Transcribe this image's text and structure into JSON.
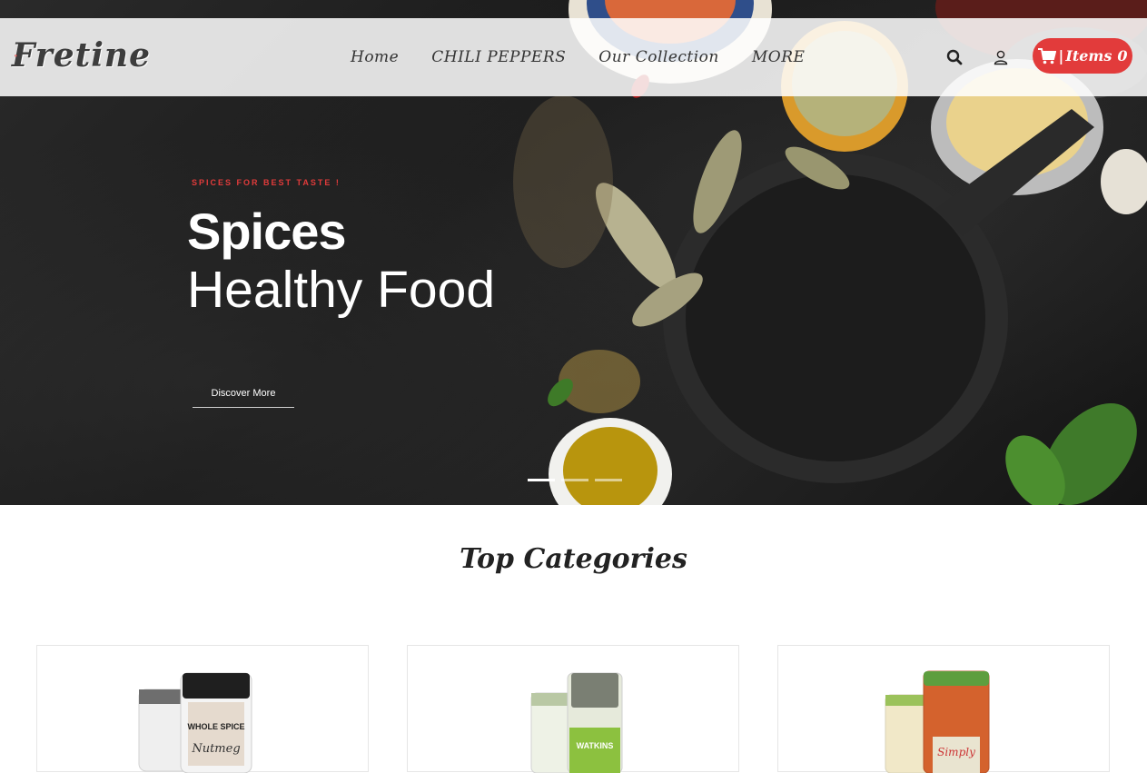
{
  "brand": {
    "name": "Fretine",
    "accent": "#e23b3b"
  },
  "nav": {
    "items": [
      "Home",
      "CHILI PEPPERS",
      "Our Collection",
      "MORE"
    ]
  },
  "header_icons": [
    "search-icon",
    "user-icon",
    "cart-icon"
  ],
  "cart": {
    "label": "Items",
    "count": "0"
  },
  "hero": {
    "tagline": "SPICES FOR BEST TASTE !",
    "title_line1": "Spices",
    "title_line2": "Healthy Food",
    "cta": "Discover More",
    "slides": 3,
    "active_slide": 1
  },
  "categories": {
    "title": "Top Categories",
    "cards": [
      {
        "front_label": "WHOLE SPICE",
        "front_label_2": "Nutmeg",
        "back_label": ""
      },
      {
        "front_label": "WATKINS",
        "front_label_2": "",
        "back_label": ""
      },
      {
        "front_label": "Simply",
        "front_label_2": "",
        "back_label": ""
      }
    ]
  }
}
